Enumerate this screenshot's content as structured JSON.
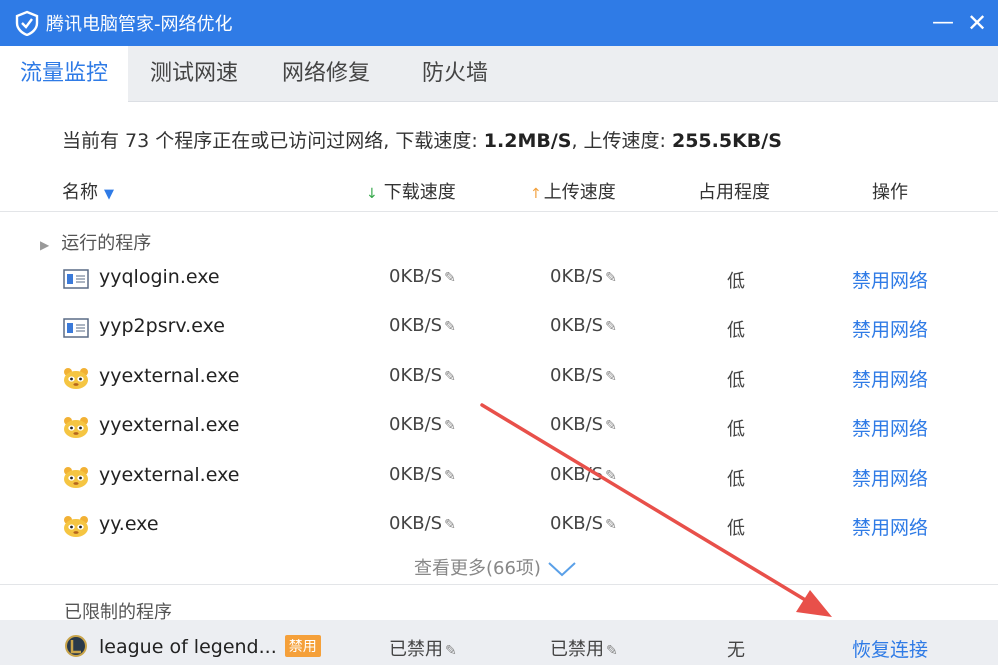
{
  "window": {
    "title": "腾讯电脑管家-网络优化",
    "minimize_glyph": "—",
    "close_glyph": "✕",
    "accent": "#2f7be6"
  },
  "tabs": [
    {
      "label": "流量监控",
      "active": true
    },
    {
      "label": "测试网速",
      "active": false
    },
    {
      "label": "网络修复",
      "active": false
    },
    {
      "label": "防火墙",
      "active": false
    }
  ],
  "summary": {
    "prefix": "当前有 73 个程序正在或已访问过网络, 下载速度: ",
    "download_speed": "1.2MB/S",
    "middle": ", 上传速度: ",
    "upload_speed": "255.5KB/S"
  },
  "columns": {
    "name": "名称",
    "download": "下载速度",
    "upload": "上传速度",
    "usage": "占用程度",
    "operation": "操作"
  },
  "running_section": {
    "title": "运行的程序",
    "rows": [
      {
        "name": "yyqlogin.exe",
        "icon": "window-app-icon",
        "down": "0KB/S",
        "up": "0KB/S",
        "usage": "低",
        "op": "禁用网络"
      },
      {
        "name": "yyp2psrv.exe",
        "icon": "window-app-icon",
        "down": "0KB/S",
        "up": "0KB/S",
        "usage": "低",
        "op": "禁用网络"
      },
      {
        "name": "yyexternal.exe",
        "icon": "yy-bear-icon",
        "down": "0KB/S",
        "up": "0KB/S",
        "usage": "低",
        "op": "禁用网络"
      },
      {
        "name": "yyexternal.exe",
        "icon": "yy-bear-icon",
        "down": "0KB/S",
        "up": "0KB/S",
        "usage": "低",
        "op": "禁用网络"
      },
      {
        "name": "yyexternal.exe",
        "icon": "yy-bear-icon",
        "down": "0KB/S",
        "up": "0KB/S",
        "usage": "低",
        "op": "禁用网络"
      },
      {
        "name": "yy.exe",
        "icon": "yy-bear-icon",
        "down": "0KB/S",
        "up": "0KB/S",
        "usage": "低",
        "op": "禁用网络"
      }
    ],
    "more": "查看更多(66项)"
  },
  "limited_section": {
    "title": "已限制的程序",
    "rows": [
      {
        "name": "league of legend...",
        "badge": "禁用",
        "icon": "lol-game-icon",
        "down": "已禁用",
        "up": "已禁用",
        "usage": "无",
        "op": "恢复连接"
      }
    ]
  },
  "colors": {
    "titlebar": "#2f7be6",
    "link": "#2f7be6",
    "badge": "#f5a03a",
    "annotation_arrow": "#e8504a"
  }
}
